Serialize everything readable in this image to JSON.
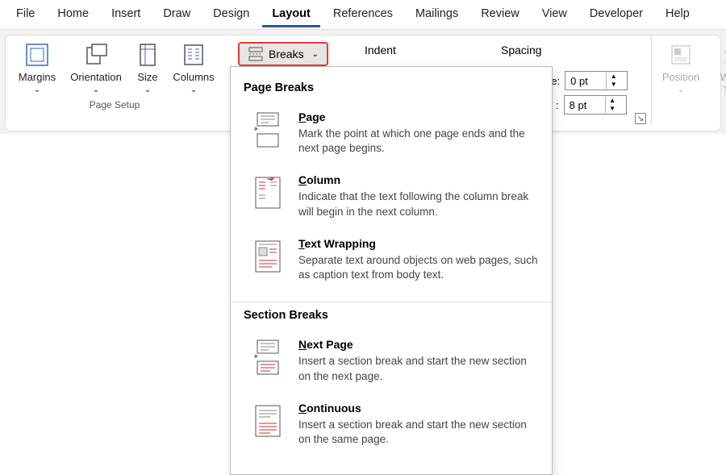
{
  "tabs": [
    "File",
    "Home",
    "Insert",
    "Draw",
    "Design",
    "Layout",
    "References",
    "Mailings",
    "Review",
    "View",
    "Developer",
    "Help"
  ],
  "active_tab": "Layout",
  "page_setup": {
    "margins": "Margins",
    "orientation": "Orientation",
    "size": "Size",
    "columns": "Columns",
    "group_label": "Page Setup"
  },
  "breaks": {
    "label": "Breaks"
  },
  "paragraph": {
    "indent_label": "Indent",
    "spacing_label": "Spacing",
    "before_suffix": "re:",
    "after_suffix": ":",
    "before_val": "0 pt",
    "after_val": "8 pt"
  },
  "arrange": {
    "position": "Position",
    "wrap": "Wrap Text"
  },
  "dropdown": {
    "page_breaks_title": "Page Breaks",
    "section_breaks_title": "Section Breaks",
    "items_page": [
      {
        "title": "Page",
        "u": "P",
        "rest": "age",
        "desc": "Mark the point at which one page ends and the next page begins."
      },
      {
        "title": "Column",
        "u": "C",
        "rest": "olumn",
        "desc": "Indicate that the text following the column break will begin in the next column."
      },
      {
        "title": "Text Wrapping",
        "u": "T",
        "rest": "ext Wrapping",
        "desc": "Separate text around objects on web pages, such as caption text from body text."
      }
    ],
    "items_section": [
      {
        "title": "Next Page",
        "u": "N",
        "rest": "ext Page",
        "desc": "Insert a section break and start the new section on the next page."
      },
      {
        "title": "Continuous",
        "u": "C",
        "rest": "ontinuous",
        "desc": "Insert a section break and start the new section on the same page."
      }
    ]
  }
}
